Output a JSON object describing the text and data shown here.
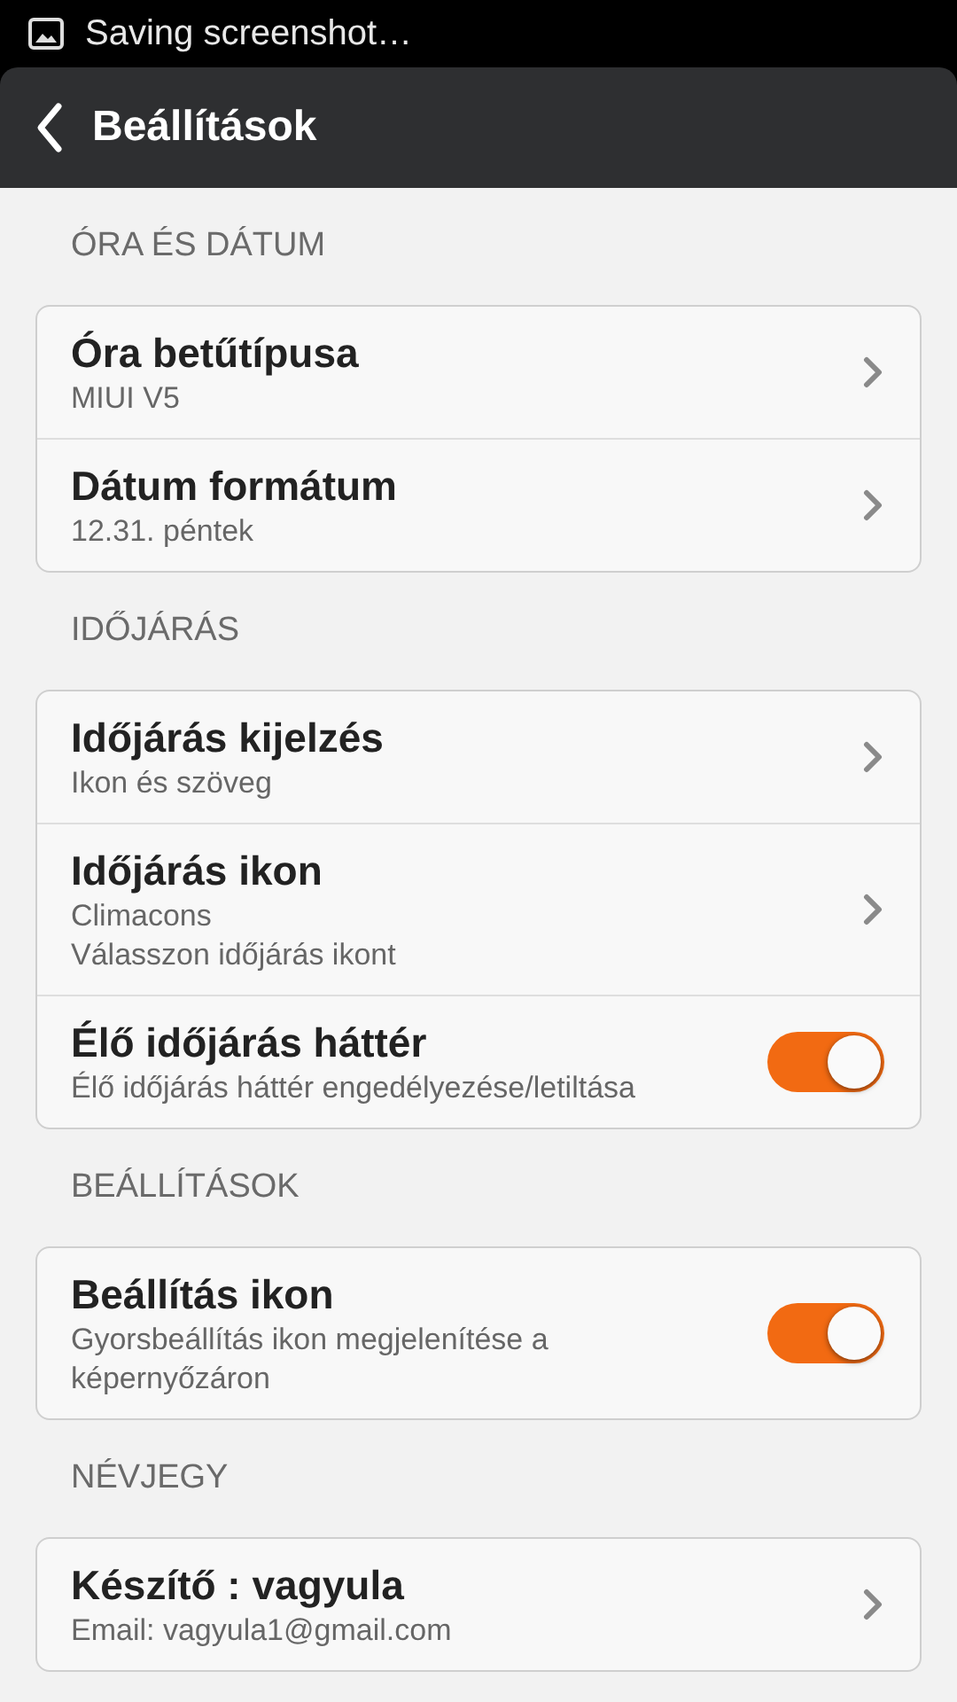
{
  "status_bar": {
    "text": "Saving screenshot…"
  },
  "header": {
    "title": "Beállítások"
  },
  "sections": [
    {
      "title": "ÓRA ÉS DÁTUM",
      "rows": [
        {
          "kind": "link",
          "title": "Óra betűtípusa",
          "subtitle": [
            "MIUI V5"
          ]
        },
        {
          "kind": "link",
          "title": "Dátum formátum",
          "subtitle": [
            "12.31. péntek"
          ]
        }
      ]
    },
    {
      "title": "IDŐJÁRÁS",
      "rows": [
        {
          "kind": "link",
          "title": "Időjárás kijelzés",
          "subtitle": [
            "Ikon és szöveg"
          ]
        },
        {
          "kind": "link",
          "title": "Időjárás ikon",
          "subtitle": [
            "Climacons",
            "Válasszon időjárás ikont"
          ]
        },
        {
          "kind": "toggle",
          "title": "Élő időjárás háttér",
          "subtitle": [
            "Élő időjárás háttér engedélyezése/letiltása"
          ],
          "on": true
        }
      ]
    },
    {
      "title": "BEÁLLÍTÁSOK",
      "rows": [
        {
          "kind": "toggle",
          "title": "Beállítás ikon",
          "subtitle": [
            "Gyorsbeállítás ikon megjelenítése a képernyőzáron"
          ],
          "on": true
        }
      ]
    },
    {
      "title": "NÉVJEGY",
      "rows": [
        {
          "kind": "link",
          "title": "Készítő : vagyula",
          "subtitle": [
            "Email: vagyula1@gmail.com"
          ]
        }
      ]
    }
  ]
}
